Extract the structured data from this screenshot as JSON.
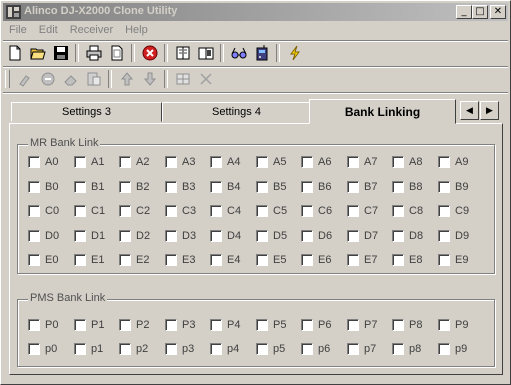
{
  "window": {
    "title": "Alinco DJ-X2000 Clone Utility"
  },
  "caption_buttons": {
    "minimize": "_",
    "maximize": "□",
    "close": "✕"
  },
  "menu": [
    {
      "label": "File"
    },
    {
      "label": "Edit"
    },
    {
      "label": "Receiver"
    },
    {
      "label": "Help"
    }
  ],
  "toolbar_main": [
    {
      "name": "new-icon"
    },
    {
      "name": "open-icon"
    },
    {
      "name": "save-icon"
    },
    "sep",
    {
      "name": "print-icon"
    },
    {
      "name": "print-preview-icon"
    },
    "sep",
    {
      "name": "stop-icon"
    },
    "sep",
    {
      "name": "book-icon"
    },
    {
      "name": "book-open-icon"
    },
    "sep",
    {
      "name": "glasses-icon"
    },
    {
      "name": "radio-icon"
    },
    "sep",
    {
      "name": "lightning-icon"
    }
  ],
  "toolbar_edit": [
    {
      "name": "brush-icon"
    },
    {
      "name": "delete-circle-icon"
    },
    {
      "name": "eraser-icon"
    },
    {
      "name": "paste-icon"
    },
    "sep",
    {
      "name": "arrow-up-icon"
    },
    {
      "name": "arrow-down-icon"
    },
    "sep",
    {
      "name": "grid-icon"
    },
    {
      "name": "close-x-icon"
    }
  ],
  "tabs": [
    {
      "label": "Settings 3"
    },
    {
      "label": "Settings 4"
    },
    {
      "label": "Bank Linking",
      "active": true
    }
  ],
  "tab_scroll": {
    "left": "◀",
    "right": "▶"
  },
  "mr_group": {
    "title": "MR Bank Link",
    "rows": [
      [
        "A0",
        "A1",
        "A2",
        "A3",
        "A4",
        "A5",
        "A6",
        "A7",
        "A8",
        "A9"
      ],
      [
        "B0",
        "B1",
        "B2",
        "B3",
        "B4",
        "B5",
        "B6",
        "B7",
        "B8",
        "B9"
      ],
      [
        "C0",
        "C1",
        "C2",
        "C3",
        "C4",
        "C5",
        "C6",
        "C7",
        "C8",
        "C9"
      ],
      [
        "D0",
        "D1",
        "D2",
        "D3",
        "D4",
        "D5",
        "D6",
        "D7",
        "D8",
        "D9"
      ],
      [
        "E0",
        "E1",
        "E2",
        "E3",
        "E4",
        "E5",
        "E6",
        "E7",
        "E8",
        "E9"
      ]
    ]
  },
  "pms_group": {
    "title": "PMS Bank Link",
    "rows": [
      [
        "P0",
        "P1",
        "P2",
        "P3",
        "P4",
        "P5",
        "P6",
        "P7",
        "P8",
        "P9"
      ],
      [
        "p0",
        "p1",
        "p2",
        "p3",
        "p4",
        "p5",
        "p6",
        "p7",
        "p8",
        "p9"
      ]
    ]
  },
  "checked": []
}
